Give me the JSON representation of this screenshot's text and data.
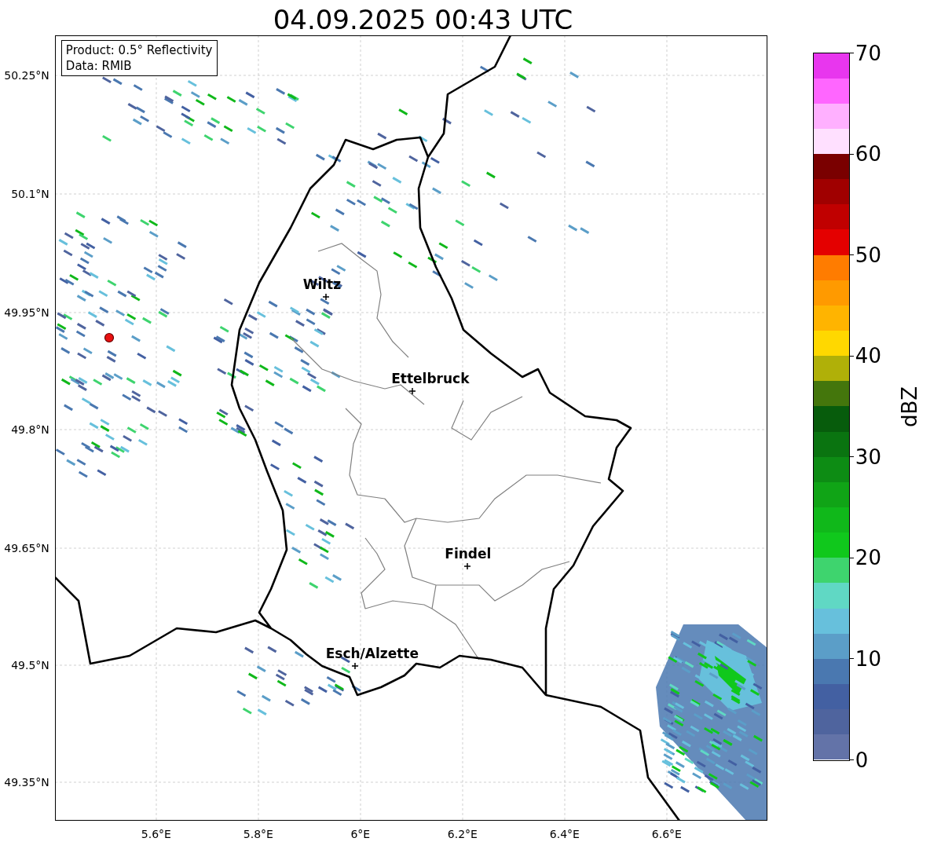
{
  "title": "04.09.2025 00:43 UTC",
  "info_box": [
    "Product: 0.5° Reflectivity",
    "Data: RMIB"
  ],
  "map": {
    "lat_ticks": [
      "50.25°N",
      "50.1°N",
      "49.95°N",
      "49.8°N",
      "49.65°N",
      "49.5°N",
      "49.35°N"
    ],
    "lon_ticks": [
      "5.6°E",
      "5.8°E",
      "6°E",
      "6.2°E",
      "6.4°E",
      "6.6°E"
    ],
    "cities": [
      {
        "name": "Wiltz"
      },
      {
        "name": "Ettelbruck"
      },
      {
        "name": "Findel"
      },
      {
        "name": "Esch/Alzette"
      }
    ]
  },
  "colorbar": {
    "label": "dBZ",
    "ticks": [
      "70",
      "60",
      "50",
      "40",
      "30",
      "20",
      "10",
      "0"
    ],
    "bins": [
      {
        "color": "#e836ee"
      },
      {
        "color": "#ff66ff"
      },
      {
        "color": "#ffb0ff"
      },
      {
        "color": "#ffe0ff"
      },
      {
        "color": "#7a0000"
      },
      {
        "color": "#a00000"
      },
      {
        "color": "#c00000"
      },
      {
        "color": "#e40000"
      },
      {
        "color": "#ff7c00"
      },
      {
        "color": "#ff9a00"
      },
      {
        "color": "#ffb400"
      },
      {
        "color": "#ffd800"
      },
      {
        "color": "#b0b008"
      },
      {
        "color": "#44760c"
      },
      {
        "color": "#075c0c"
      },
      {
        "color": "#0a7410"
      },
      {
        "color": "#0d8c14"
      },
      {
        "color": "#10a416"
      },
      {
        "color": "#10b81a"
      },
      {
        "color": "#10c81c"
      },
      {
        "color": "#3ed46e"
      },
      {
        "color": "#60d8c4"
      },
      {
        "color": "#67c0dc"
      },
      {
        "color": "#5b9ec8"
      },
      {
        "color": "#4a78b0"
      },
      {
        "color": "#4360a2"
      },
      {
        "color": "#4f649e"
      },
      {
        "color": "#6373a8"
      }
    ]
  }
}
